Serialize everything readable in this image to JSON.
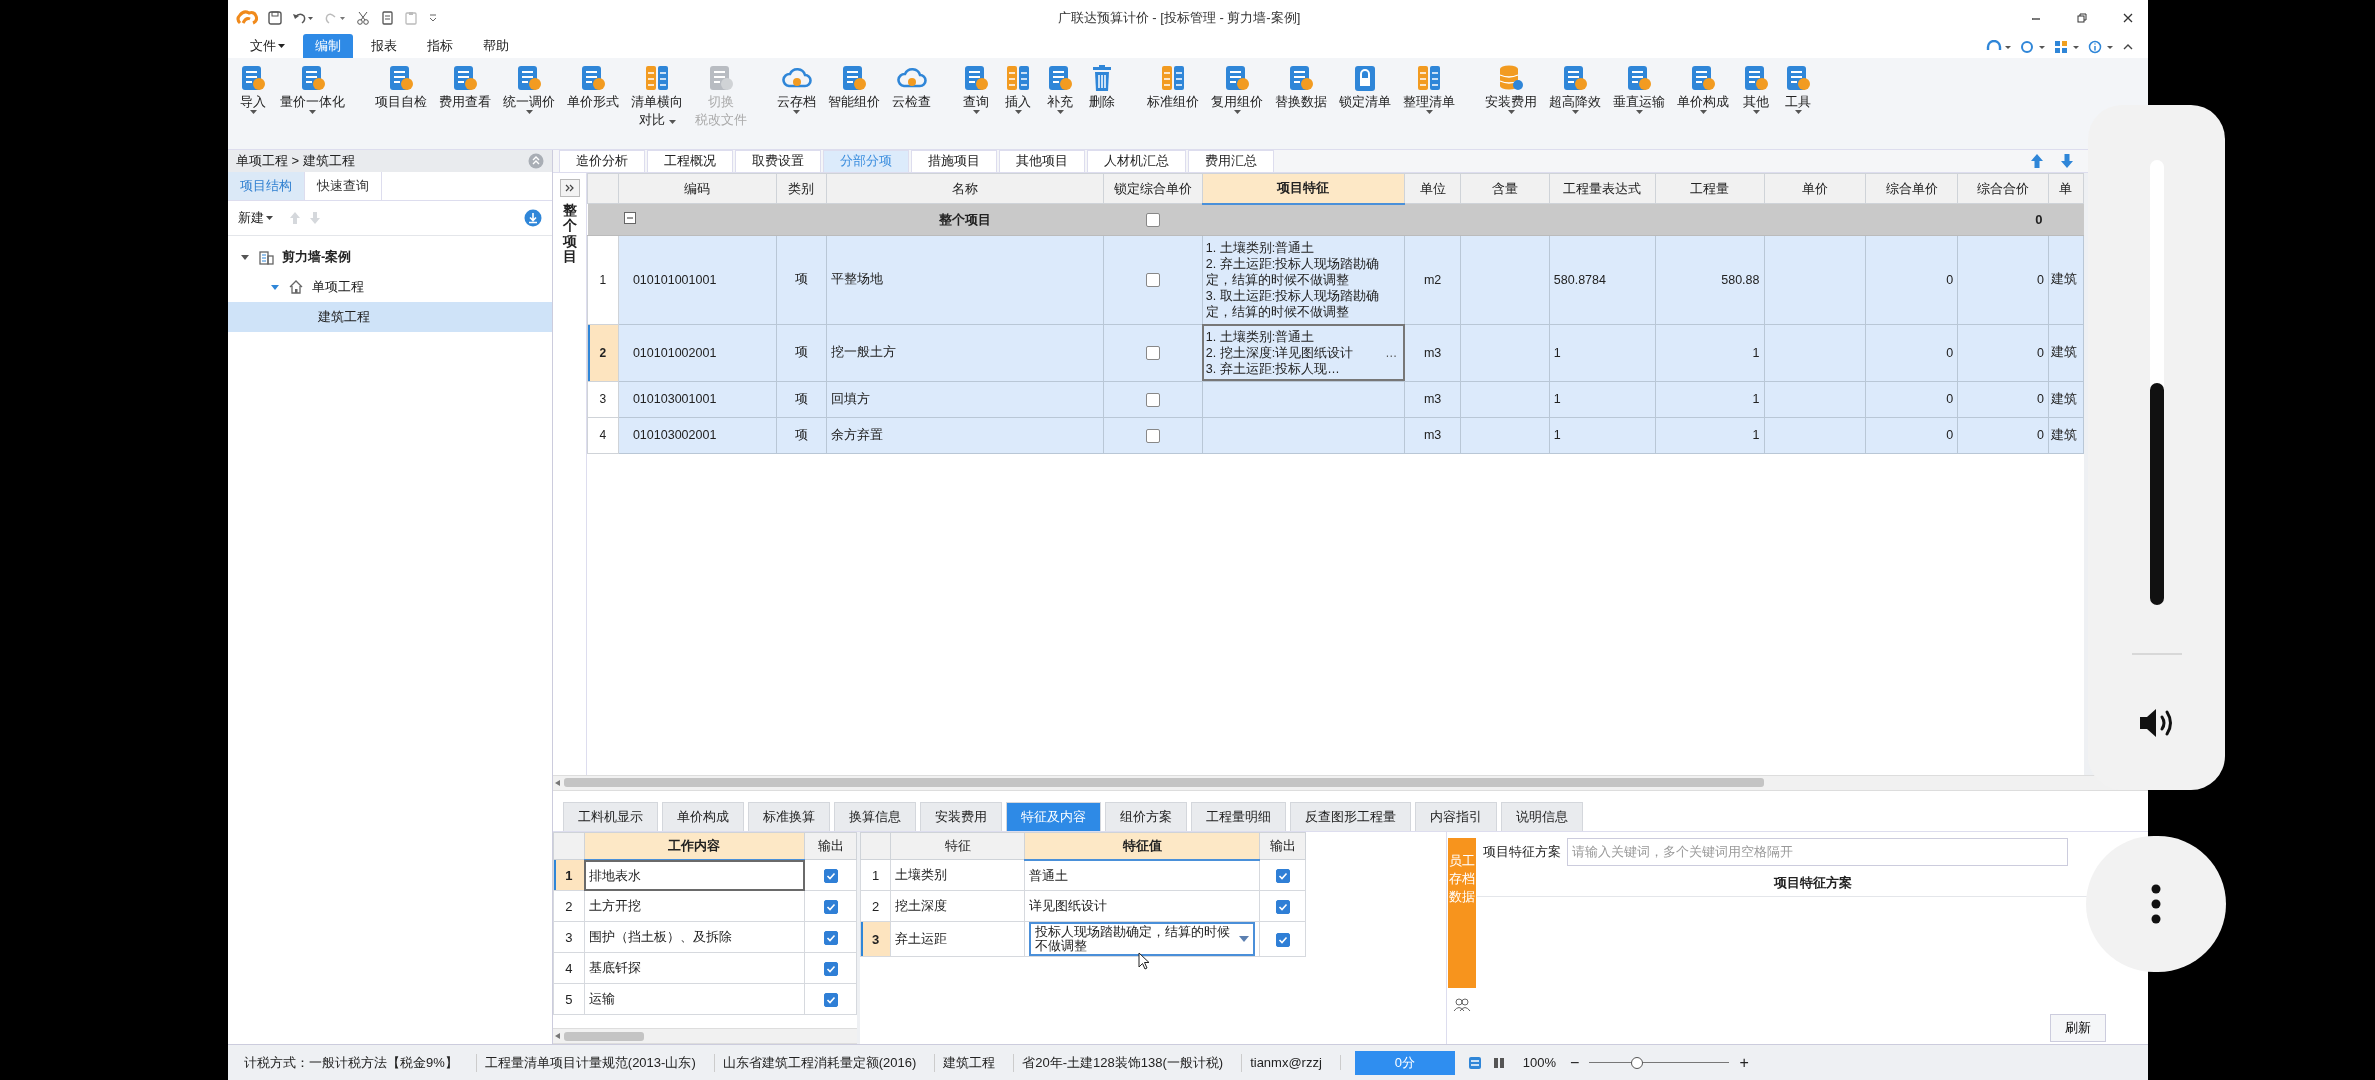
{
  "title_bar": {
    "title": "广联达预算计价 - [投标管理 - 剪力墙-案例]"
  },
  "menu": [
    {
      "label": "文件",
      "caret": true,
      "selected": false
    },
    {
      "label": "编制",
      "caret": false,
      "selected": true
    },
    {
      "label": "报表",
      "caret": false,
      "selected": false
    },
    {
      "label": "指标",
      "caret": false,
      "selected": false
    },
    {
      "label": "帮助",
      "caret": false,
      "selected": false
    }
  ],
  "ribbon": [
    {
      "buttons": [
        {
          "lines": [
            "导入"
          ],
          "caret": true,
          "disabled": false
        },
        {
          "lines": [
            "量价一体化"
          ],
          "caret": true,
          "disabled": false
        }
      ]
    },
    {
      "buttons": [
        {
          "lines": [
            "项目自检"
          ],
          "caret": false,
          "disabled": false
        },
        {
          "lines": [
            "费用查看"
          ],
          "caret": false,
          "disabled": false
        },
        {
          "lines": [
            "统一调价"
          ],
          "caret": true,
          "disabled": false
        },
        {
          "lines": [
            "单价形式"
          ],
          "caret": false,
          "disabled": false
        },
        {
          "lines": [
            "清单横向",
            "对比"
          ],
          "caret": true,
          "disabled": false
        },
        {
          "lines": [
            "切换",
            "税改文件"
          ],
          "caret": false,
          "disabled": true
        }
      ]
    },
    {
      "buttons": [
        {
          "lines": [
            "云存档"
          ],
          "caret": true,
          "disabled": false
        },
        {
          "lines": [
            "智能组价"
          ],
          "caret": false,
          "disabled": false
        },
        {
          "lines": [
            "云检查"
          ],
          "caret": false,
          "disabled": false
        }
      ]
    },
    {
      "buttons": [
        {
          "lines": [
            "查询"
          ],
          "caret": true,
          "disabled": false
        },
        {
          "lines": [
            "插入"
          ],
          "caret": true,
          "disabled": false
        },
        {
          "lines": [
            "补充"
          ],
          "caret": true,
          "disabled": false
        },
        {
          "lines": [
            "删除"
          ],
          "caret": false,
          "disabled": false
        }
      ]
    },
    {
      "buttons": [
        {
          "lines": [
            "标准组价"
          ],
          "caret": false,
          "disabled": false
        },
        {
          "lines": [
            "复用组价"
          ],
          "caret": true,
          "disabled": false
        },
        {
          "lines": [
            "替换数据"
          ],
          "caret": false,
          "disabled": false
        },
        {
          "lines": [
            "锁定清单"
          ],
          "caret": false,
          "disabled": false
        },
        {
          "lines": [
            "整理清单"
          ],
          "caret": true,
          "disabled": false
        }
      ]
    },
    {
      "buttons": [
        {
          "lines": [
            "安装费用"
          ],
          "caret": true,
          "disabled": false
        },
        {
          "lines": [
            "超高降效"
          ],
          "caret": true,
          "disabled": false
        },
        {
          "lines": [
            "垂直运输"
          ],
          "caret": true,
          "disabled": false
        },
        {
          "lines": [
            "单价构成"
          ],
          "caret": true,
          "disabled": false
        },
        {
          "lines": [
            "其他"
          ],
          "caret": true,
          "disabled": false
        },
        {
          "lines": [
            "工具"
          ],
          "caret": true,
          "disabled": false
        }
      ]
    }
  ],
  "left_panel": {
    "breadcrumb": "单项工程 > 建筑工程",
    "tabs": [
      {
        "label": "项目结构",
        "selected": true
      },
      {
        "label": "快速查询",
        "selected": false
      }
    ],
    "new_button": "新建",
    "tree": [
      {
        "label": "剪力墙-案例",
        "kind": "project",
        "expanded": true,
        "selected": false,
        "children": [
          {
            "label": "单项工程",
            "kind": "unit",
            "expanded": true,
            "selected": false,
            "children": [
              {
                "label": "建筑工程",
                "selected": true
              }
            ]
          }
        ]
      }
    ]
  },
  "main_tabs": [
    {
      "label": "造价分析",
      "selected": false
    },
    {
      "label": "工程概况",
      "selected": false
    },
    {
      "label": "取费设置",
      "selected": false
    },
    {
      "label": "分部分项",
      "selected": true
    },
    {
      "label": "措施项目",
      "selected": false
    },
    {
      "label": "其他项目",
      "selected": false
    },
    {
      "label": "人材机汇总",
      "selected": false
    },
    {
      "label": "费用汇总",
      "selected": false
    }
  ],
  "grid": {
    "side_label": "整个项目",
    "columns": [
      {
        "label": "编码",
        "selected": false
      },
      {
        "label": "类别",
        "selected": false
      },
      {
        "label": "名称",
        "selected": false
      },
      {
        "label": "锁定综合单价",
        "selected": false
      },
      {
        "label": "项目特征",
        "selected": true
      },
      {
        "label": "单位",
        "selected": false
      },
      {
        "label": "含量",
        "selected": false
      },
      {
        "label": "工程量表达式",
        "selected": false
      },
      {
        "label": "工程量",
        "selected": false
      },
      {
        "label": "单价",
        "selected": false
      },
      {
        "label": "综合单价",
        "selected": false
      },
      {
        "label": "综合合价",
        "selected": false
      },
      {
        "label": "单",
        "selected": false
      }
    ],
    "group_row": {
      "name": "整个项目",
      "expanded": true,
      "locked": false,
      "total": "0"
    },
    "rows": [
      {
        "index": "1",
        "code": "010101001001",
        "type": "项",
        "name": "平整场地",
        "locked": false,
        "features": [
          "1. 土壤类别:普通土",
          "2. 弃土运距:投标人现场踏勘确定，结算的时候不做调整",
          "3. 取土运距:投标人现场踏勘确定，结算的时候不做调整"
        ],
        "unit": "m2",
        "expression": "580.8784",
        "quantity": "580.88",
        "composite_unit_price": "0",
        "composite_total": "0",
        "column_13": "建筑",
        "selected": false
      },
      {
        "index": "2",
        "code": "010101002001",
        "type": "项",
        "name": "挖一般土方",
        "locked": false,
        "features": [
          "1. 土壤类别:普通土",
          "2. 挖土深度:详见图纸设计",
          "3. 弃土运距:投标人现…"
        ],
        "feature_button": "…",
        "unit": "m3",
        "expression": "1",
        "quantity": "1",
        "composite_unit_price": "0",
        "composite_total": "0",
        "column_13": "建筑",
        "selected": true
      },
      {
        "index": "3",
        "code": "010103001001",
        "type": "项",
        "name": "回填方",
        "locked": false,
        "unit": "m3",
        "expression": "1",
        "quantity": "1",
        "composite_unit_price": "0",
        "composite_total": "0",
        "column_13": "建筑",
        "selected": false
      },
      {
        "index": "4",
        "code": "010103002001",
        "type": "项",
        "name": "余方弃置",
        "locked": false,
        "unit": "m3",
        "expression": "1",
        "quantity": "1",
        "composite_unit_price": "0",
        "composite_total": "0",
        "column_13": "建筑",
        "selected": false
      }
    ]
  },
  "bottom_tabs": [
    {
      "label": "工料机显示",
      "selected": false
    },
    {
      "label": "单价构成",
      "selected": false
    },
    {
      "label": "标准换算",
      "selected": false
    },
    {
      "label": "换算信息",
      "selected": false
    },
    {
      "label": "安装费用",
      "selected": false
    },
    {
      "label": "特征及内容",
      "selected": true
    },
    {
      "label": "组价方案",
      "selected": false
    },
    {
      "label": "工程量明细",
      "selected": false
    },
    {
      "label": "反查图形工程量",
      "selected": false
    },
    {
      "label": "内容指引",
      "selected": false
    },
    {
      "label": "说明信息",
      "selected": false
    }
  ],
  "work_content": {
    "columns": [
      {
        "label": "工作内容",
        "selected": true
      },
      {
        "label": "输出",
        "selected": false
      }
    ],
    "rows": [
      {
        "index": "1",
        "text": "排地表水",
        "output": true,
        "selected": true
      },
      {
        "index": "2",
        "text": "土方开挖",
        "output": true,
        "selected": false
      },
      {
        "index": "3",
        "text": "围护（挡土板）、及拆除",
        "output": true,
        "selected": false
      },
      {
        "index": "4",
        "text": "基底钎探",
        "output": true,
        "selected": false
      },
      {
        "index": "5",
        "text": "运输",
        "output": true,
        "selected": false
      }
    ]
  },
  "features": {
    "columns": [
      {
        "label": "特征",
        "selected": false
      },
      {
        "label": "特征值",
        "selected": true
      },
      {
        "label": "输出",
        "selected": false
      }
    ],
    "rows": [
      {
        "index": "1",
        "feature": "土壤类别",
        "value": "普通土",
        "output": true,
        "selected": false
      },
      {
        "index": "2",
        "feature": "挖土深度",
        "value": "详见图纸设计",
        "output": true,
        "selected": false
      },
      {
        "index": "3",
        "feature": "弃土运距",
        "value": "投标人现场踏勘确定，结算的时候不做调整",
        "output": true,
        "selected": true
      }
    ]
  },
  "scheme_panel": {
    "side_tab": "员工存档数据",
    "label": "项目特征方案",
    "placeholder": "请输入关键词，多个关键词用空格隔开",
    "heading": "项目特征方案",
    "refresh_button": "刷新"
  },
  "status_bar": {
    "items": [
      "计税方式：一般计税方法【税金9%】",
      "工程量清单项目计量规范(2013-山东)",
      "山东省建筑工程消耗量定额(2016)",
      "建筑工程",
      "省20年-土建128装饰138(一般计税)",
      "tianmx@rzzj"
    ],
    "score": "0分",
    "zoom": "100%",
    "zoom_out": "−",
    "zoom_in": "+",
    "zoom_slider": {
      "level": 0.34
    }
  }
}
